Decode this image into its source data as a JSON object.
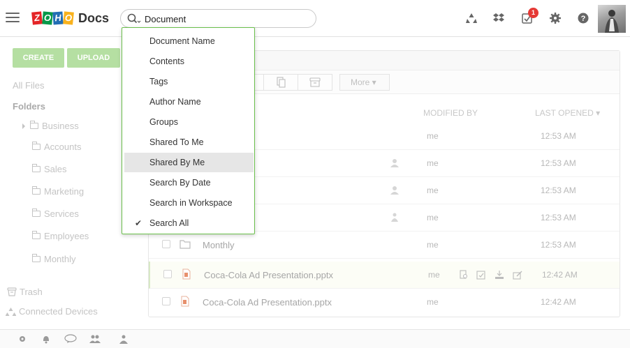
{
  "header": {
    "logo_letters": [
      "Z",
      "O",
      "H",
      "O"
    ],
    "logo_colors": [
      "#e42527",
      "#089949",
      "#226db4",
      "#f9b21d"
    ],
    "app_name": "Docs",
    "search": {
      "value": "Document"
    },
    "notification_count": "1",
    "icons": [
      "recycle-icon",
      "dropbox-icon",
      "tasks-icon",
      "gear-icon",
      "help-icon"
    ]
  },
  "sidebar": {
    "create_label": "CREATE",
    "upload_label": "UPLOAD",
    "all_files": "All Files",
    "folders_heading": "Folders",
    "folders": [
      "Business",
      "Accounts",
      "Sales",
      "Marketing",
      "Services",
      "Employees",
      "Monthly"
    ],
    "trash": "Trash",
    "connected_devices": "Connected Devices"
  },
  "search_dropdown": {
    "items": [
      "Document Name",
      "Contents",
      "Tags",
      "Author Name",
      "Groups",
      "Shared To Me",
      "Shared By Me",
      "Search By Date",
      "Search in Workspace",
      "Search All"
    ],
    "hovered_item": "Shared By Me",
    "checked_item": "Search All",
    "check_glyph": "✔"
  },
  "toolbar": {
    "more_label": "More ▾"
  },
  "file_table": {
    "columns": {
      "modified_by": "MODIFIED BY",
      "last_opened": "LAST OPENED ▾"
    },
    "rows": [
      {
        "name": "",
        "modified_by": "me",
        "last_opened": "12:53 AM"
      },
      {
        "name": "",
        "modified_by": "me",
        "last_opened": "12:53 AM"
      },
      {
        "name": "",
        "modified_by": "me",
        "last_opened": "12:53 AM"
      },
      {
        "name": "",
        "modified_by": "me",
        "last_opened": "12:53 AM"
      },
      {
        "name": "Monthly",
        "modified_by": "me",
        "last_opened": "12:53 AM"
      },
      {
        "name": "Coca-Cola Ad Presentation.pptx",
        "modified_by": "me",
        "last_opened": "12:42 AM"
      },
      {
        "name": "Coca-Cola Ad Presentation.pptx",
        "modified_by": "me",
        "last_opened": "12:42 AM"
      }
    ]
  },
  "colors": {
    "accent_green": "#b5dfa2",
    "dropdown_border": "#6abf4b",
    "badge_red": "#e53935"
  }
}
